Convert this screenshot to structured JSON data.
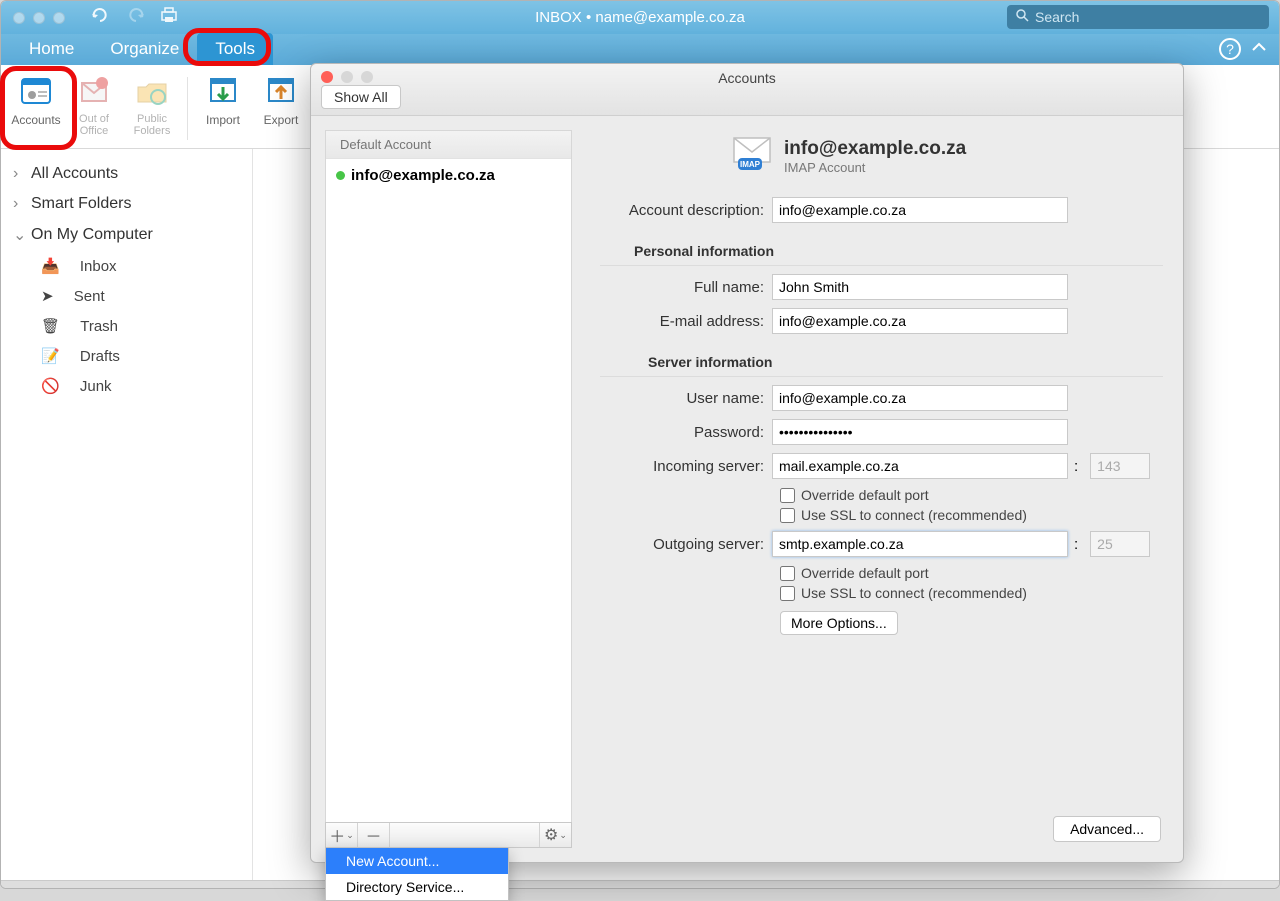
{
  "window": {
    "title": "INBOX • name@example.co.za",
    "search_placeholder": "Search"
  },
  "tabs": {
    "home": "Home",
    "organize": "Organize",
    "tools": "Tools"
  },
  "ribbon": {
    "accounts": "Accounts",
    "out_of_office": "Out of",
    "out_of_office2": "Office",
    "public_folders": "Public",
    "public_folders2": "Folders",
    "import": "Import",
    "export": "Export"
  },
  "sidebar": {
    "all_accounts": "All Accounts",
    "smart_folders": "Smart Folders",
    "on_my_computer": "On My Computer",
    "inbox": "Inbox",
    "sent": "Sent",
    "trash": "Trash",
    "drafts": "Drafts",
    "junk": "Junk"
  },
  "accounts_win": {
    "title": "Accounts",
    "show_all": "Show All",
    "default_account": "Default Account",
    "account_email": "info@example.co.za",
    "menu_new_account": "New Account...",
    "menu_directory": "Directory Service...",
    "header_email": "info@example.co.za",
    "header_sub": "IMAP Account",
    "labels": {
      "description": "Account description:",
      "personal_info": "Personal information",
      "full_name": "Full name:",
      "email": "E-mail address:",
      "server_info": "Server information",
      "username": "User name:",
      "password": "Password:",
      "incoming": "Incoming server:",
      "override": "Override default port",
      "ssl": "Use SSL to connect (recommended)",
      "outgoing": "Outgoing server:",
      "more_options": "More Options...",
      "advanced": "Advanced..."
    },
    "values": {
      "description": "info@example.co.za",
      "full_name": "John Smith",
      "email": "info@example.co.za",
      "username": "info@example.co.za",
      "password": "•••••••••••••••",
      "incoming": "mail.example.co.za",
      "incoming_port": "143",
      "outgoing": "smtp.example.co.za",
      "outgoing_port": "25"
    }
  }
}
